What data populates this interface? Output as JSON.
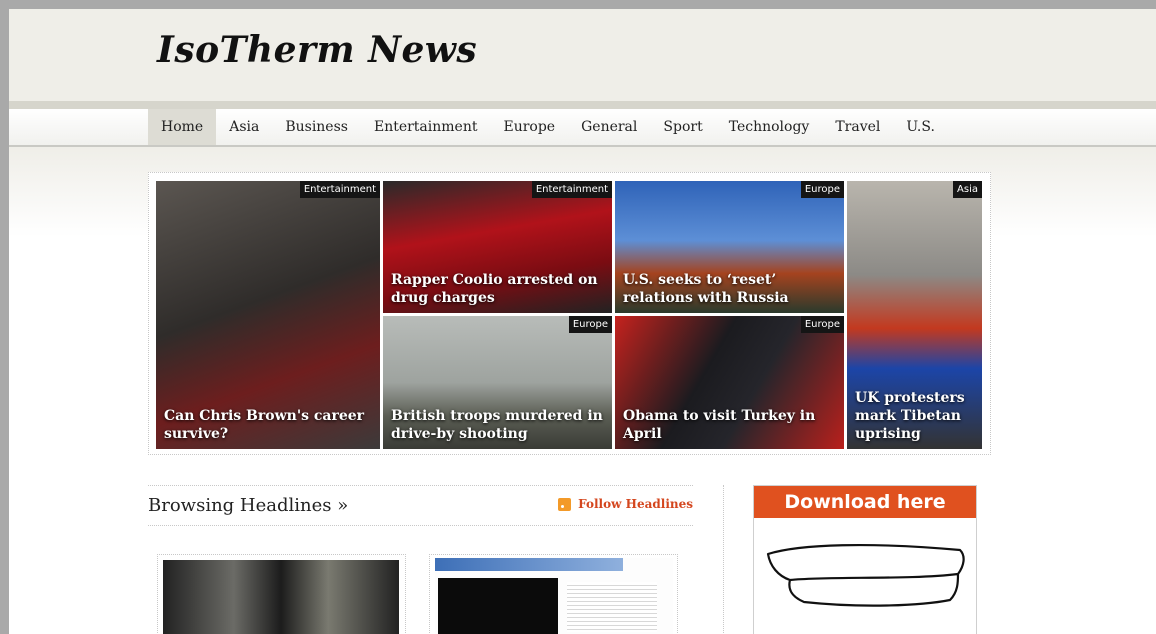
{
  "site": {
    "logo": "IsoTherm News"
  },
  "nav": {
    "items": [
      {
        "label": "Home",
        "active": true
      },
      {
        "label": "Asia"
      },
      {
        "label": "Business"
      },
      {
        "label": "Entertainment"
      },
      {
        "label": "Europe"
      },
      {
        "label": "General"
      },
      {
        "label": "Sport"
      },
      {
        "label": "Technology"
      },
      {
        "label": "Travel"
      },
      {
        "label": "U.S."
      }
    ]
  },
  "featured": [
    {
      "category": "Entertainment",
      "title": "Can Chris Brown's career survive?"
    },
    {
      "category": "Entertainment",
      "title": "Rapper Coolio arrested on drug charges"
    },
    {
      "category": "Europe",
      "title": "U.S. seeks to ‘reset’ relations with Russia"
    },
    {
      "category": "Asia",
      "title": "UK protesters mark Tibetan uprising"
    },
    {
      "category": "Europe",
      "title": "British troops murdered in drive-by shooting"
    },
    {
      "category": "Europe",
      "title": "Obama to visit Turkey in April"
    }
  ],
  "headlines": {
    "title": "Browsing Headlines »",
    "follow_label": "Follow Headlines"
  },
  "ad": {
    "button_label": "Download here"
  },
  "colors": {
    "accent": "#d4461e",
    "ad": "#e0511f",
    "header_bg": "#efeee8"
  }
}
